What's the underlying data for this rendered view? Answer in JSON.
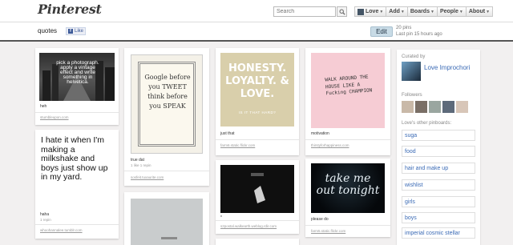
{
  "header": {
    "logo": "Pinterest",
    "search_placeholder": "Search",
    "nav": [
      "Love",
      "Add",
      "Boards",
      "People",
      "About"
    ]
  },
  "board": {
    "title": "quotes",
    "like_label": "Like",
    "edit_label": "Edit",
    "pin_count": "20 pins",
    "last_pin": "Last pin 15 hours ago"
  },
  "pins": [
    {
      "image_text": "pick a photograph. apply a vintage effect and write something in helvetica.",
      "desc": "heh",
      "meta": "",
      "source": "stumbleupon.com"
    },
    {
      "image_text": "I hate it when I'm making a milkshake and boys just show up in my yard.",
      "desc": "haha",
      "meta": "1 repin",
      "source": "whoohannalee.tumblr.com"
    },
    {
      "image_text": "Google before you TWEET think before you SPEAK",
      "desc": "true dat",
      "meta": "1 like   1 repin",
      "source": "sosfeit.tuxaurite.com"
    },
    {
      "image_text": "",
      "desc": "",
      "meta": "",
      "source": ""
    },
    {
      "image_text": "HONESTY. LOYALTY. & LOVE.",
      "sub_text": "IS IT THAT HARD?",
      "desc": "just that",
      "meta": "",
      "source": "farm6.static.flickr.com"
    },
    {
      "image_text": "",
      "desc": "*",
      "meta": "",
      "source": "s2postal.walkearth.weblog.rdir.com"
    },
    {
      "image_text": "WALK AROUND THE HOUSE LIKE A Fucking CHAMPION",
      "desc": "motivation",
      "meta": "",
      "source": "thirstyforhappiness.com"
    },
    {
      "image_text": "take me out tonight",
      "desc": "please do",
      "meta": "",
      "source": "farm5.static.flickr.com"
    }
  ],
  "sidebar": {
    "curated_label": "Curated by",
    "curator": "Love Improchori",
    "followers_label": "Followers",
    "other_label": "Love's other pinboards:",
    "boards": [
      "suga",
      "food",
      "hair and make up",
      "wishlist",
      "girls",
      "boys",
      "imperial cosmic stellar"
    ]
  },
  "colors": {
    "accent": "#3a6ab5",
    "edit_bg": "#c8dbe6"
  }
}
